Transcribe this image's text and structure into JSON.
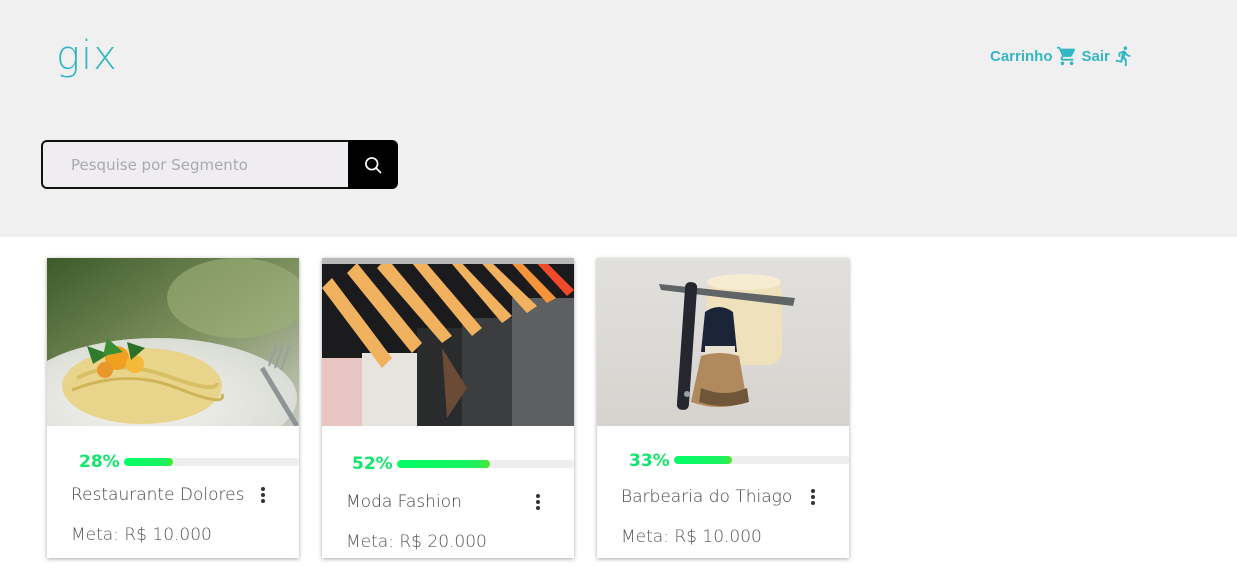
{
  "brand": {
    "logo_text": "gix",
    "accent_color": "#34b7c4"
  },
  "nav": {
    "cart_label": "Carrinho",
    "cart_icon": "cart-icon",
    "logout_label": "Sair",
    "logout_icon": "running-person-icon"
  },
  "search": {
    "placeholder": "Pesquise por Segmento",
    "value": "",
    "button_icon": "search-icon"
  },
  "progress_color": "#10e66a",
  "cards": [
    {
      "name": "Restaurante Dolores",
      "percent_label": "28%",
      "progress": 0.28,
      "meta": "Meta: R$ 10.000",
      "image": "pasta-dish-photo"
    },
    {
      "name": "Moda Fashion",
      "percent_label": "52%",
      "progress": 0.52,
      "meta": "Meta: R$ 20.000",
      "image": "clothes-hangers-photo"
    },
    {
      "name": "Barbearia do Thiago",
      "percent_label": "33%",
      "progress": 0.33,
      "meta": "Meta: R$ 10.000",
      "image": "razor-brush-photo"
    }
  ]
}
